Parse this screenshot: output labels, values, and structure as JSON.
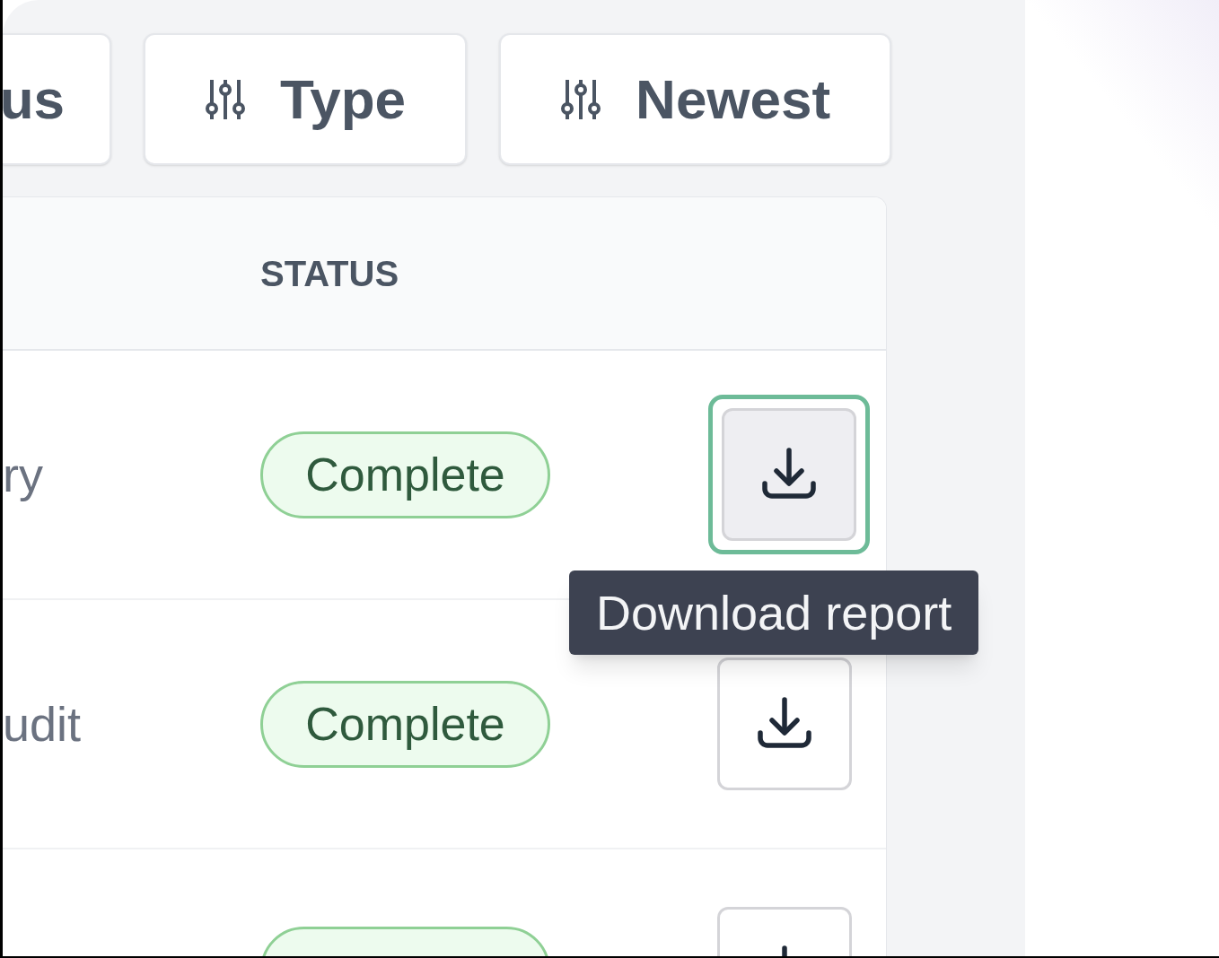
{
  "filters": [
    {
      "label": "us"
    },
    {
      "label": "Type",
      "icon_visible": true
    },
    {
      "label": "Newest",
      "icon_visible": true
    }
  ],
  "table": {
    "columns": [
      {
        "label": "STATUS"
      }
    ],
    "rows": [
      {
        "name": "ry",
        "status": "Complete",
        "focused": true
      },
      {
        "name": "udit",
        "status": "Complete",
        "focused": false
      },
      {
        "focused": false
      }
    ]
  },
  "tooltip": "Download report"
}
